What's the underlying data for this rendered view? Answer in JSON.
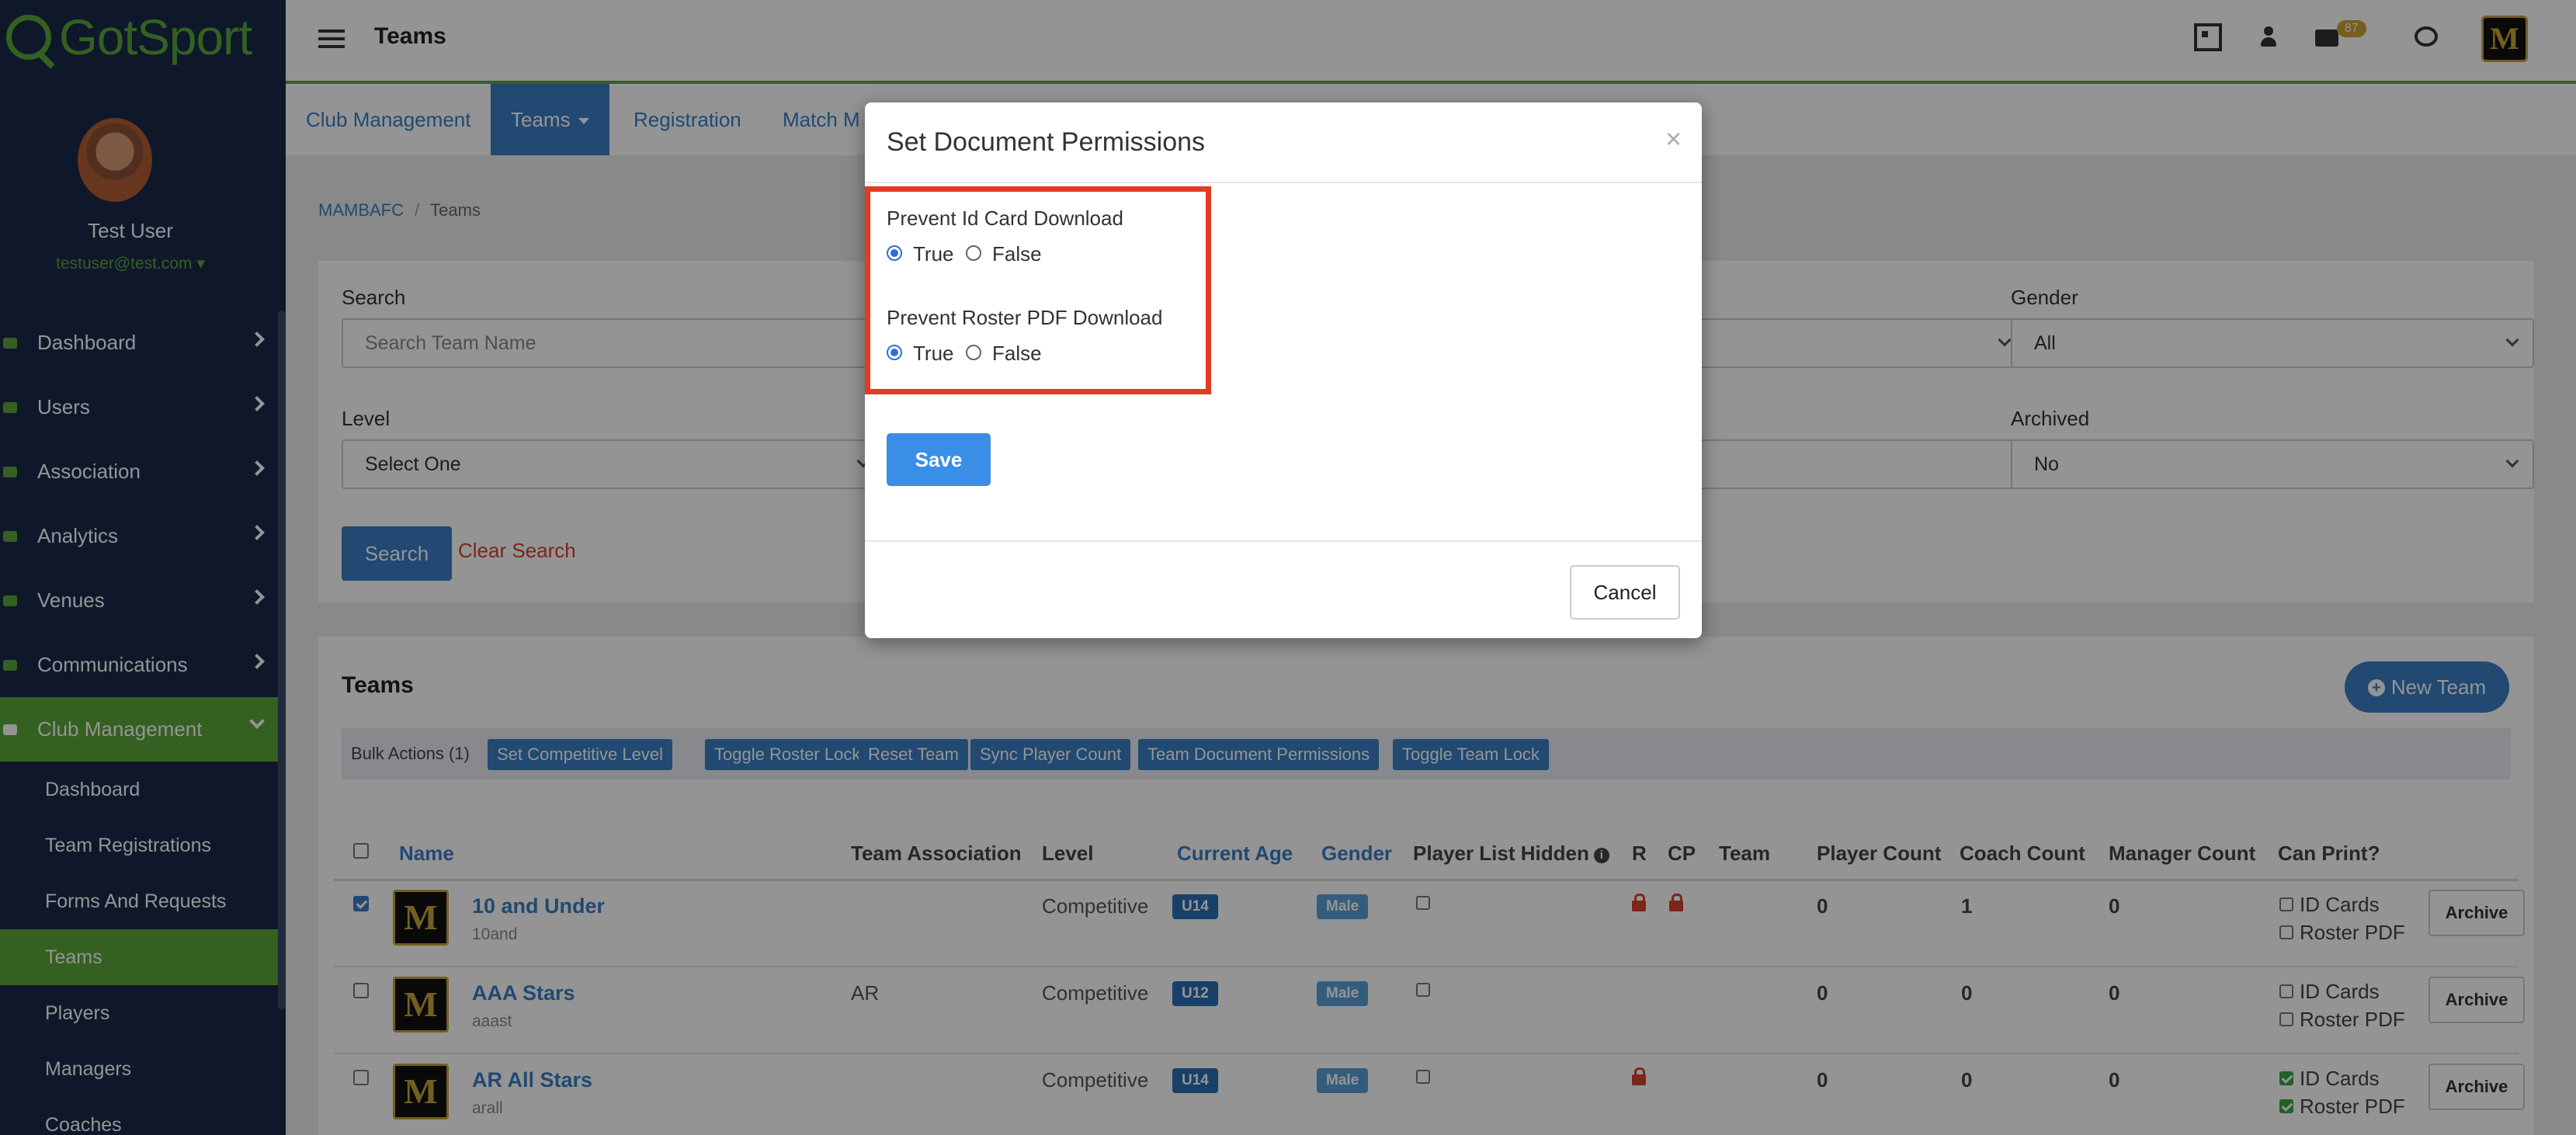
{
  "brand": {
    "name": "GotSport",
    "accent": "#5aa53a",
    "sidebar_bg": "#1b2a4a",
    "link": "#3a7fc4"
  },
  "user": {
    "name": "Test User",
    "email": "testuser@test.com"
  },
  "sidebar": {
    "items": [
      {
        "label": "Dashboard",
        "icon": "dashboard-icon"
      },
      {
        "label": "Users",
        "icon": "users-icon"
      },
      {
        "label": "Association",
        "icon": "sitemap-icon"
      },
      {
        "label": "Analytics",
        "icon": "chart-icon"
      },
      {
        "label": "Venues",
        "icon": "home-icon"
      },
      {
        "label": "Communications",
        "icon": "comments-icon"
      },
      {
        "label": "Club Management",
        "icon": "club-icon",
        "expanded": true
      }
    ],
    "sub_items": [
      {
        "label": "Dashboard"
      },
      {
        "label": "Team Registrations"
      },
      {
        "label": "Forms And Requests"
      },
      {
        "label": "Teams",
        "active": true
      },
      {
        "label": "Players"
      },
      {
        "label": "Managers"
      },
      {
        "label": "Coaches"
      }
    ]
  },
  "header": {
    "title": "Teams",
    "mail_count": "87"
  },
  "tabs": [
    {
      "label": "Club Management"
    },
    {
      "label": "Teams",
      "active": true
    },
    {
      "label": "Registration"
    },
    {
      "label": "Match M"
    }
  ],
  "breadcrumb": {
    "root": "MAMBAFC",
    "current": "Teams"
  },
  "filters": {
    "search_label": "Search",
    "search_placeholder": "Search Team Name",
    "gender_label": "Gender",
    "gender_value": "All",
    "level_label": "Level",
    "level_value": "Select One",
    "archived_label": "Archived",
    "archived_value": "No",
    "search_button": "Search",
    "clear_link": "Clear Search"
  },
  "teams": {
    "title": "Teams",
    "new_team": "New Team",
    "bulk_label": "Bulk Actions (1)",
    "bulk_actions": [
      "Set Competitive Level",
      "Toggle Roster Lock",
      "Reset Team",
      "Sync Player Count",
      "Team Document Permissions",
      "Toggle Team Lock"
    ],
    "columns": {
      "name": "Name",
      "association": "Team Association",
      "level": "Level",
      "age": "Current Age",
      "gender": "Gender",
      "hidden": "Player List Hidden",
      "r": "R",
      "cp": "CP",
      "team": "Team",
      "player_count": "Player Count",
      "coach_count": "Coach Count",
      "manager_count": "Manager Count",
      "can_print": "Can Print?"
    },
    "rows": [
      {
        "name": "10 and Under",
        "code": "10and",
        "association": "",
        "level": "Competitive",
        "age": "U14",
        "gender": "Male",
        "players": "0",
        "coaches": "1",
        "managers": "0",
        "id_cards": "ID Cards",
        "roster_pdf": "Roster PDF",
        "archive": "Archive",
        "logo_letter": "M"
      },
      {
        "name": "AAA Stars",
        "code": "aaast",
        "association": "AR",
        "level": "Competitive",
        "age": "U12",
        "gender": "Male",
        "players": "0",
        "coaches": "0",
        "managers": "0",
        "id_cards": "ID Cards",
        "roster_pdf": "Roster PDF",
        "archive": "Archive",
        "logo_letter": "M"
      },
      {
        "name": "AR All Stars",
        "code": "arall",
        "association": "",
        "level": "Competitive",
        "age": "U14",
        "gender": "Male",
        "players": "0",
        "coaches": "0",
        "managers": "0",
        "id_cards": "ID Cards",
        "roster_pdf": "Roster PDF",
        "archive": "Archive",
        "logo_letter": "M"
      }
    ]
  },
  "modal": {
    "title": "Set Document Permissions",
    "close": "×",
    "q1": "Prevent Id Card Download",
    "q2": "Prevent Roster PDF Download",
    "true_label": "True",
    "false_label": "False",
    "q1_value": "True",
    "q2_value": "True",
    "save": "Save",
    "cancel": "Cancel"
  }
}
